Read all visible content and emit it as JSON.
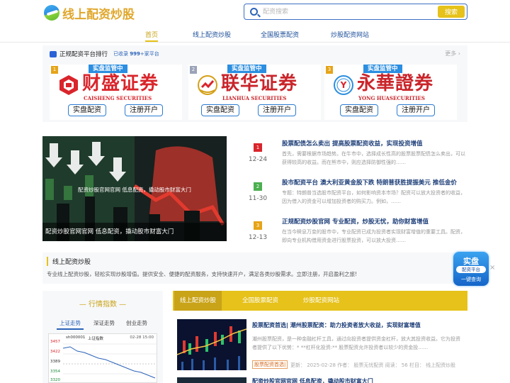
{
  "header": {
    "logo_text": "线上配资炒股",
    "search_placeholder": "配资搜索",
    "search_button": "搜索"
  },
  "nav": {
    "items": [
      {
        "label": "首页",
        "active": true
      },
      {
        "label": "线上配资炒股"
      },
      {
        "label": "全国股票配资"
      },
      {
        "label": "炒股配资网站"
      }
    ]
  },
  "ranking": {
    "title": "正规配资平台排行",
    "count_prefix": "已收录",
    "count": "999",
    "count_suffix": "+家平台",
    "more": "更多",
    "tag": "实盘监管中",
    "cards": [
      {
        "num": "1",
        "name": "财盛证券",
        "en": "CAISHENG SECURITIES",
        "color": "#d9252b",
        "num_color": "#e6a418",
        "btn1": "实盘配资",
        "btn2": "注册开户"
      },
      {
        "num": "2",
        "name": "联华证券",
        "en": "LIANHUA SECURITIES",
        "color": "#d9252b",
        "num_color": "#9aa3b8",
        "btn1": "实盘配资",
        "btn2": "注册开户"
      },
      {
        "num": "3",
        "name": "永華證券",
        "en": "YONG HUASECURITIES",
        "color": "#c9252b",
        "num_color": "#e6a418",
        "btn1": "实盘配资",
        "btn2": "注册开户"
      }
    ]
  },
  "feature": {
    "center_text": "配资炒股官网官网 低息配资，撬动股市财富大门",
    "caption": "配资炒股官网官网 低息配资，撬动股市财富大门"
  },
  "news": [
    {
      "num": "1",
      "date": "12-24",
      "color": "#d9252b",
      "title": "股票配债怎么卖出 提高股票配资收益，实现投资增值",
      "summary": "首先，需要根据市场趋势。在牛市中，选择成长性高的股票股票配债怎么卖出，可以获得较高的收益。而在熊市中，则应选择防御性强的……"
    },
    {
      "num": "2",
      "date": "11-30",
      "color": "#4caf50",
      "title": "股市配资平台 澳大利亚黄金股下跌 特朗普获胜提振美元 推低金价",
      "summary": "专题：特朗普当选股市配资平台，如何影响资本市场？配资可以放大投资者的收益，因为借入的资金可以增加投资者的购买力。例如，……"
    },
    {
      "num": "3",
      "date": "12-13",
      "color": "#e6a418",
      "title": "正规配资炒股官网 专业配资，炒股无忧，助你财富增值",
      "summary": "在当今瞬息万变的股市中，专业配资已成为投资者实现财富增值的重要工具。配资，即向专业机构借用资金进行股票投资，可以放大投资……"
    }
  ],
  "intro": {
    "title": "线上配资炒股",
    "text": "专业线上配资炒股，轻松实现炒股增值。提供安全、便捷的配资服务，支持快速开户，满足各类炒股需求。立即注册，开启盈利之旅!"
  },
  "float_badge": {
    "line1": "实盘",
    "line2": "配资平台",
    "line3": "一键查询",
    "close": "×"
  },
  "market": {
    "title": "行情指数",
    "tabs": [
      {
        "label": "上证走势",
        "active": true
      },
      {
        "label": "深证走势"
      },
      {
        "label": "创业走势"
      }
    ],
    "chart_code": "sh000001",
    "chart_name": "上证指数",
    "chart_date": "02-28 15:00",
    "ticks": [
      "3457",
      "3422",
      "3389",
      "3354",
      "3320"
    ]
  },
  "categories": [
    {
      "label": "线上配资炒股",
      "active": true
    },
    {
      "label": "全国股票配资"
    },
    {
      "label": "炒股配资网站"
    }
  ],
  "article": {
    "title": "股票配资首选| 潮州股票配资：助力投资者放大收益，实现财富增值",
    "summary": "潮州股票配资，是一种金融杠杆工具，通过向投资者提供资金杠杆，放大其投资收益。它为投资者提供了以下优势：* **杠杆化投资:** 股票配资允许投资者以较少的资金投……",
    "tag": "股票配资首选|",
    "meta": "更新： 2025-02-28    作者： 股票无忧配资    阅读： 56    栏目： 线上配资炒股"
  },
  "article2": {
    "title": "配资炒股官网官网 低息配资，撬动股市财富大门"
  }
}
